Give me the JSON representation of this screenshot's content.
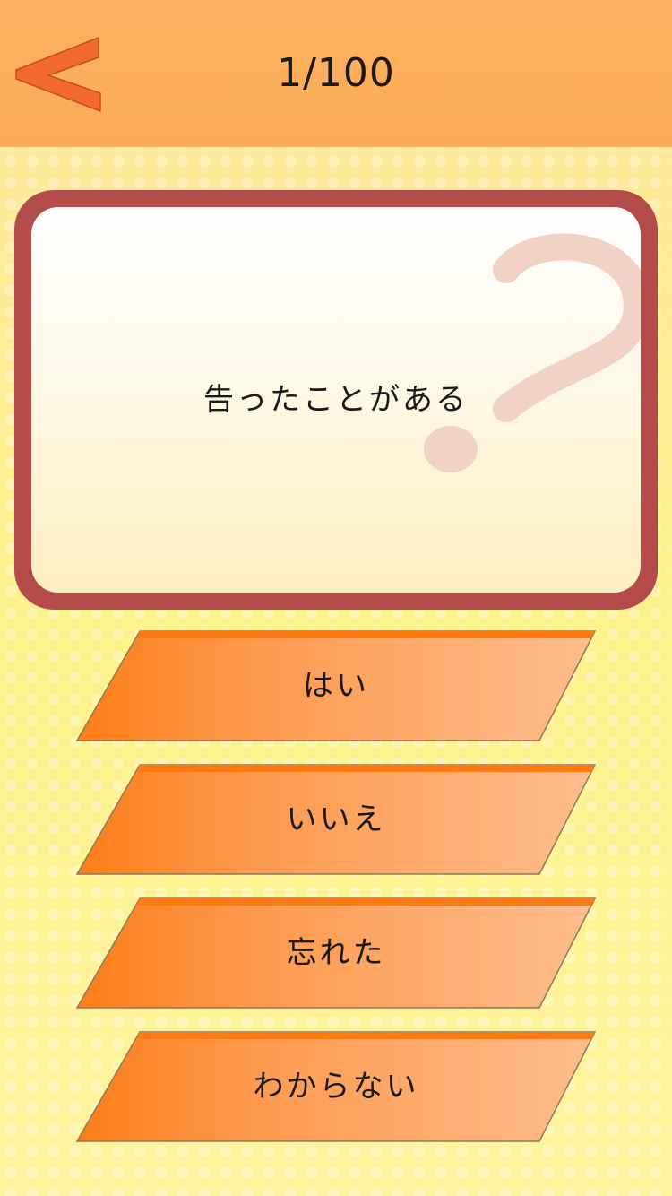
{
  "header": {
    "back_icon": "chevron-left-icon",
    "counter": "1/100"
  },
  "question": {
    "text": "告ったことがある",
    "decoration_icon": "question-mark-icon"
  },
  "answers": [
    {
      "label": "はい"
    },
    {
      "label": "いいえ"
    },
    {
      "label": "忘れた"
    },
    {
      "label": "わからない"
    }
  ],
  "colors": {
    "header_bg": "#fbac58",
    "back_arrow": "#f26a2e",
    "card_border": "#b34b4b",
    "answer_start": "#fc7f1c",
    "answer_end": "#fdb98a",
    "answer_top_stripe": "#fd7a12"
  }
}
